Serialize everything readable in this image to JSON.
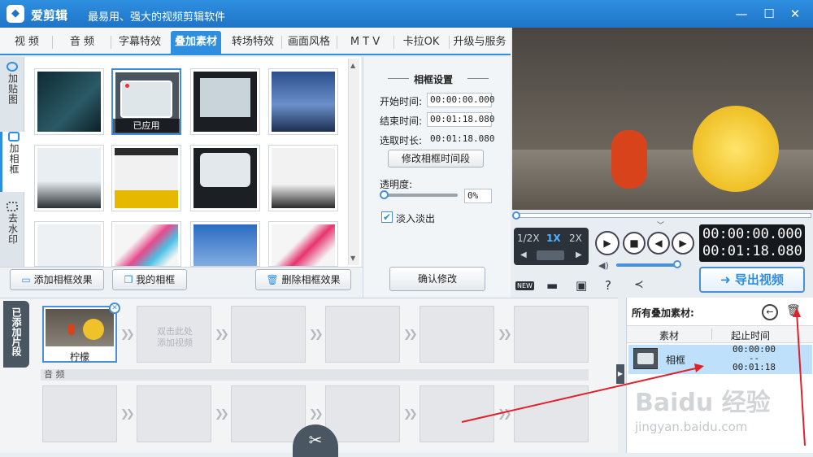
{
  "window": {
    "app_name": "爱剪辑",
    "slogan": "最易用、强大的视频剪辑软件",
    "logo_glyph": "◆"
  },
  "tabs": [
    "视 频",
    "音 频",
    "字幕特效",
    "叠加素材",
    "转场特效",
    "画面风格",
    "M T V",
    "卡拉OK",
    "升级与服务"
  ],
  "active_tab_index": 3,
  "left_nav": [
    {
      "label": "加贴图"
    },
    {
      "label": "加相框"
    },
    {
      "label": "去水印"
    }
  ],
  "grid": {
    "applied_label": "已应用"
  },
  "frame_settings": {
    "title": "相框设置",
    "start_label": "开始时间:",
    "start_value": "00:00:00.000",
    "end_label": "结束时间:",
    "end_value": "00:01:18.080",
    "duration_label": "选取时长:",
    "duration_value": "00:01:18.080",
    "modify_button": "修改相框时间段",
    "opacity_label": "透明度:",
    "opacity_value": "0%",
    "fade_label": "淡入淡出",
    "confirm_button": "确认修改"
  },
  "actions": {
    "add_frame": "添加相框效果",
    "my_frames": "我的相框",
    "delete_frame": "删除相框效果"
  },
  "preview": {
    "speed_half": "1/2X",
    "speed_1x": "1X",
    "speed_2x": "2X",
    "time_current": "00:00:00.000",
    "time_total": "00:01:18.080",
    "export_button": "导出视频",
    "new_badge": "NEW"
  },
  "clips": {
    "tab_label": "已添加片段",
    "first_clip_label": "柠檬",
    "placeholder_line1": "双击此处",
    "placeholder_line2": "添加视频",
    "audio_label": "音 频"
  },
  "overlay_list": {
    "title": "所有叠加素材:",
    "col_material": "素材",
    "col_time": "起止时间",
    "rows": [
      {
        "name": "相框",
        "start": "00:00:00",
        "dash": "--",
        "end": "00:01:18"
      }
    ]
  },
  "watermark": {
    "brand": "Baidu 经验",
    "url": "jingyan.baidu.com"
  },
  "colors": {
    "accent": "#2e8fe0",
    "arrow_red": "#e0202a",
    "selection_blue": "#bfe0fb"
  }
}
